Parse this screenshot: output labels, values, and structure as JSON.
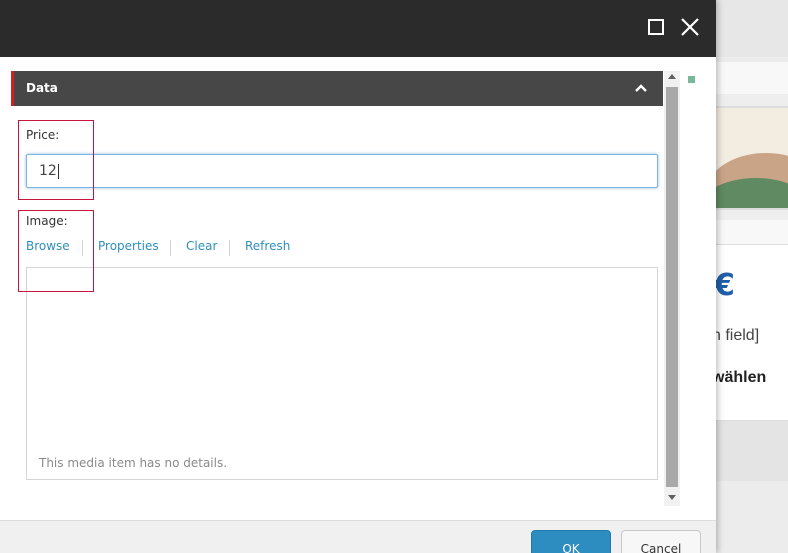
{
  "dialog": {
    "section": {
      "title": "Data"
    },
    "fields": {
      "price": {
        "label": "Price:",
        "value": "12"
      },
      "image": {
        "label": "Image:",
        "actions": {
          "browse": "Browse",
          "properties": "Properties",
          "clear": "Clear",
          "refresh": "Refresh"
        },
        "details_note": "This media item has no details."
      }
    },
    "footer": {
      "ok_label": "OK",
      "cancel_label": "Cancel"
    }
  },
  "background_page": {
    "currency_symbol": "€",
    "field_text": "n field]",
    "select_text": "wählen"
  },
  "icons": {
    "maximize": "maximize-icon",
    "close": "close-icon",
    "collapse": "chevron-up-icon"
  },
  "colors": {
    "titlebar": "#2b2b2b",
    "section_header": "#474747",
    "section_accent": "#d1201f",
    "link": "#2f8fb9",
    "primary_button": "#2d8dc1",
    "highlight": "#c4163b"
  }
}
